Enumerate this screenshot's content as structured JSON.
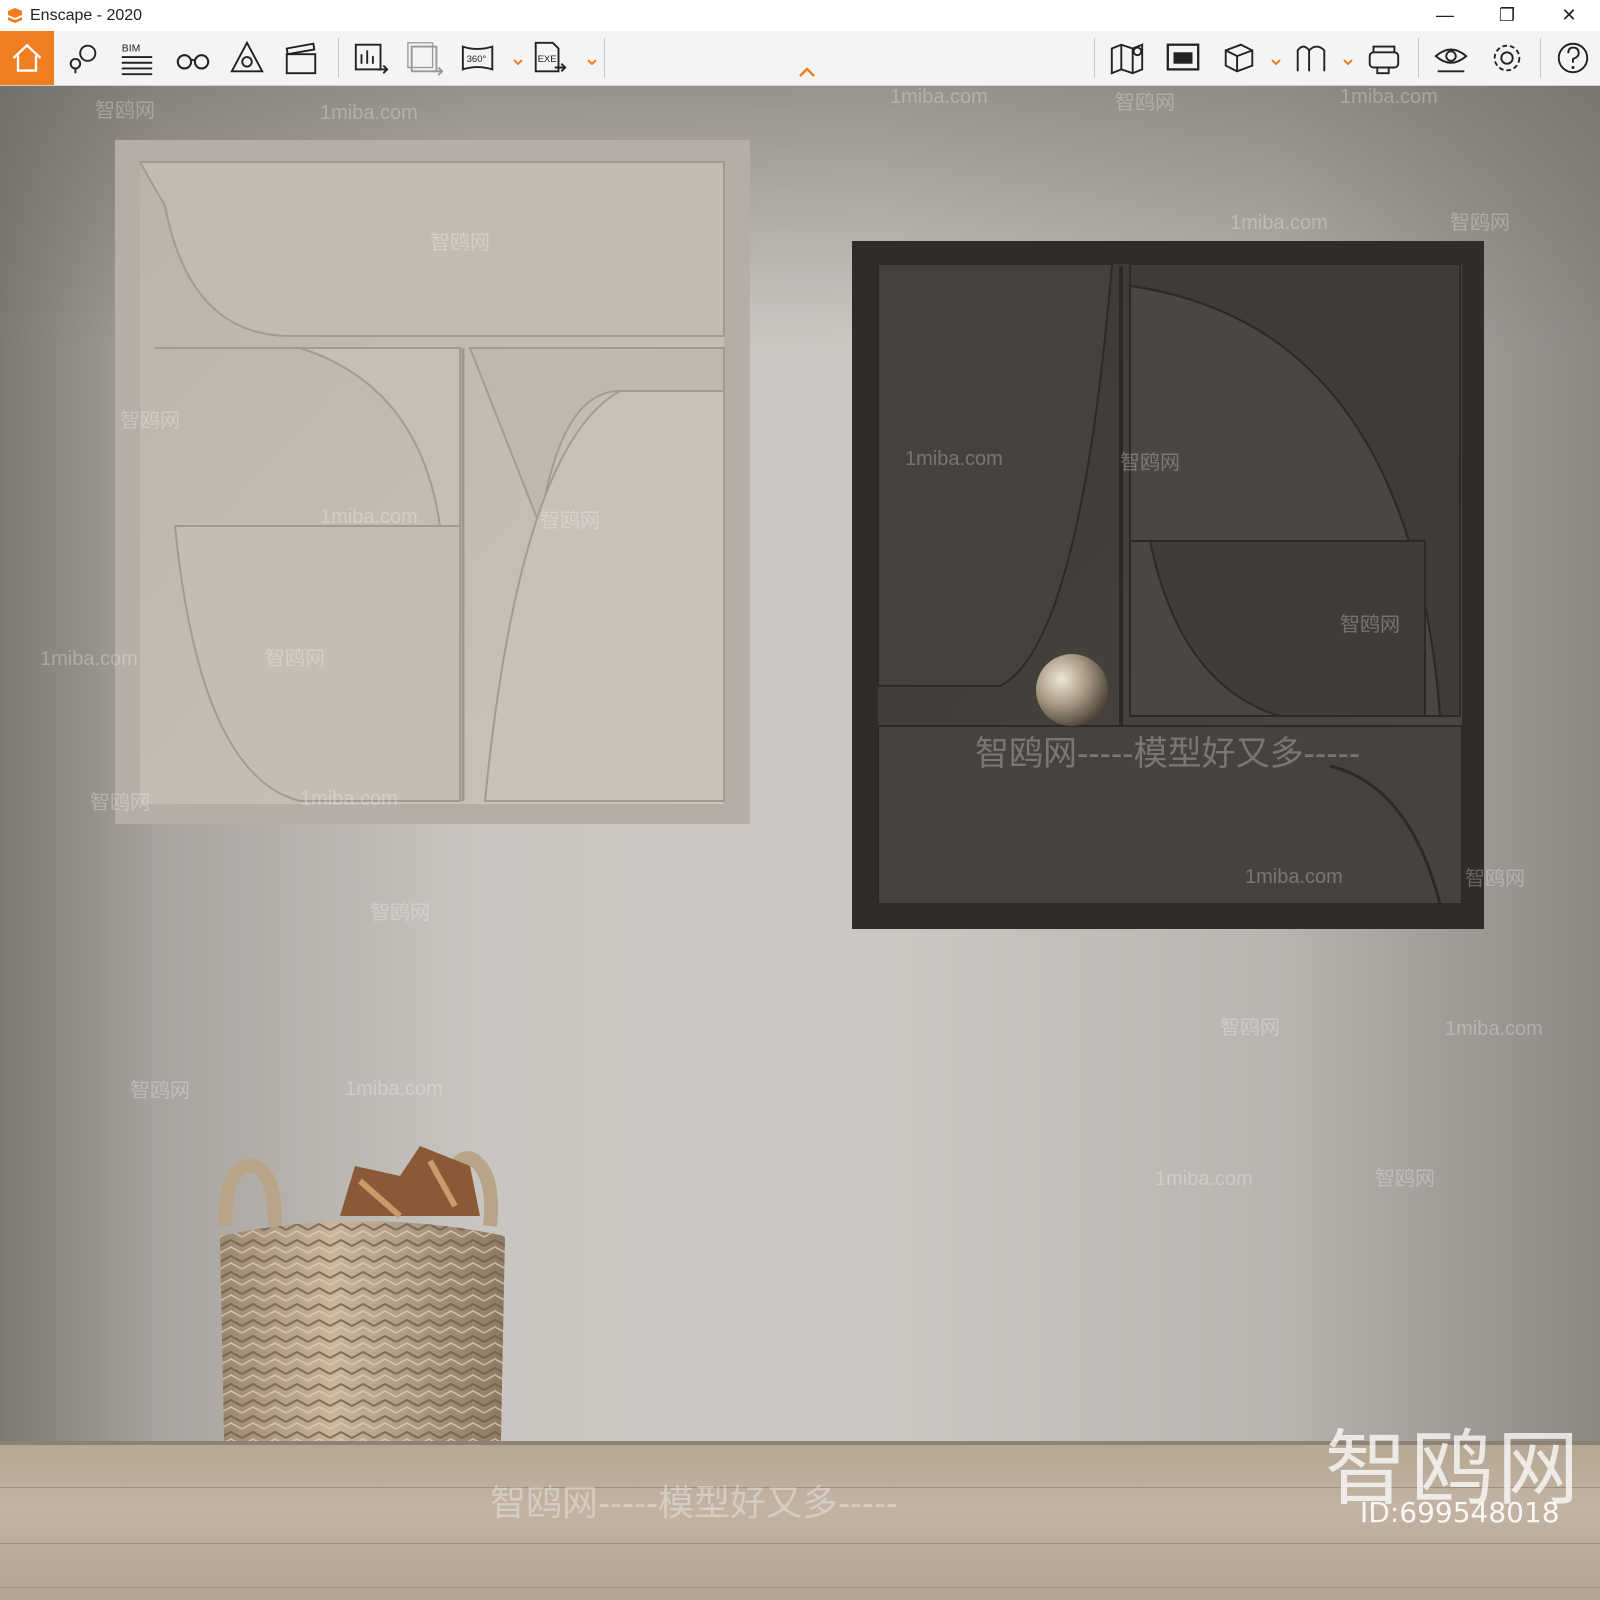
{
  "window": {
    "title": "Enscape - 2020",
    "minimize": "—",
    "restore": "❐",
    "close": "✕"
  },
  "toolbar": {
    "left": [
      {
        "name": "home-icon"
      },
      {
        "name": "location-tag-icon"
      },
      {
        "name": "bim-icon",
        "label": "BIM"
      },
      {
        "name": "binoculars-icon"
      },
      {
        "name": "light-view-icon"
      },
      {
        "name": "clapperboard-icon"
      },
      {
        "name": "render-image-icon"
      },
      {
        "name": "batch-render-icon"
      },
      {
        "name": "panorama-360-icon",
        "label": "360°"
      },
      {
        "name": "export-exe-icon",
        "label": "EXE"
      }
    ],
    "right": [
      {
        "name": "map-icon"
      },
      {
        "name": "mini-map-icon"
      },
      {
        "name": "asset-library-icon"
      },
      {
        "name": "material-editor-icon"
      },
      {
        "name": "vr-headset-icon"
      },
      {
        "name": "visual-settings-icon"
      },
      {
        "name": "settings-gear-icon"
      },
      {
        "name": "help-icon"
      }
    ],
    "accent": "#ef7d22"
  },
  "watermarks": {
    "site": "1miba.com",
    "cn": "智鸥网",
    "dash": "- - - - -",
    "slogan": "智鸥网-----模型好又多-----",
    "slogan_bottom": "智鸥网-----模型好又多-----",
    "big": "智鸥网",
    "id": "ID:699548018"
  }
}
